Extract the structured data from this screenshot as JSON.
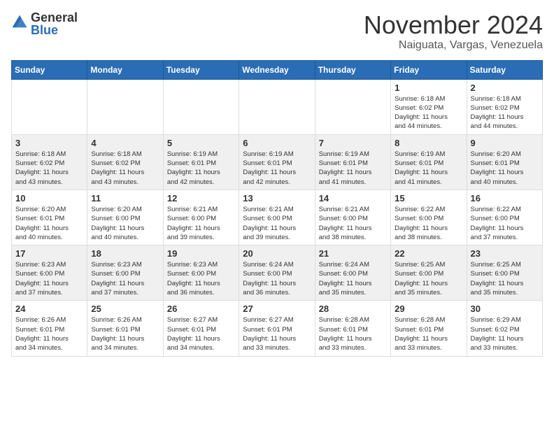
{
  "header": {
    "logo_general": "General",
    "logo_blue": "Blue",
    "month_title": "November 2024",
    "location": "Naiguata, Vargas, Venezuela"
  },
  "calendar": {
    "days_of_week": [
      "Sunday",
      "Monday",
      "Tuesday",
      "Wednesday",
      "Thursday",
      "Friday",
      "Saturday"
    ],
    "weeks": [
      [
        {
          "day": "",
          "info": ""
        },
        {
          "day": "",
          "info": ""
        },
        {
          "day": "",
          "info": ""
        },
        {
          "day": "",
          "info": ""
        },
        {
          "day": "",
          "info": ""
        },
        {
          "day": "1",
          "info": "Sunrise: 6:18 AM\nSunset: 6:02 PM\nDaylight: 11 hours\nand 44 minutes."
        },
        {
          "day": "2",
          "info": "Sunrise: 6:18 AM\nSunset: 6:02 PM\nDaylight: 11 hours\nand 44 minutes."
        }
      ],
      [
        {
          "day": "3",
          "info": "Sunrise: 6:18 AM\nSunset: 6:02 PM\nDaylight: 11 hours\nand 43 minutes."
        },
        {
          "day": "4",
          "info": "Sunrise: 6:18 AM\nSunset: 6:02 PM\nDaylight: 11 hours\nand 43 minutes."
        },
        {
          "day": "5",
          "info": "Sunrise: 6:19 AM\nSunset: 6:01 PM\nDaylight: 11 hours\nand 42 minutes."
        },
        {
          "day": "6",
          "info": "Sunrise: 6:19 AM\nSunset: 6:01 PM\nDaylight: 11 hours\nand 42 minutes."
        },
        {
          "day": "7",
          "info": "Sunrise: 6:19 AM\nSunset: 6:01 PM\nDaylight: 11 hours\nand 41 minutes."
        },
        {
          "day": "8",
          "info": "Sunrise: 6:19 AM\nSunset: 6:01 PM\nDaylight: 11 hours\nand 41 minutes."
        },
        {
          "day": "9",
          "info": "Sunrise: 6:20 AM\nSunset: 6:01 PM\nDaylight: 11 hours\nand 40 minutes."
        }
      ],
      [
        {
          "day": "10",
          "info": "Sunrise: 6:20 AM\nSunset: 6:01 PM\nDaylight: 11 hours\nand 40 minutes."
        },
        {
          "day": "11",
          "info": "Sunrise: 6:20 AM\nSunset: 6:00 PM\nDaylight: 11 hours\nand 40 minutes."
        },
        {
          "day": "12",
          "info": "Sunrise: 6:21 AM\nSunset: 6:00 PM\nDaylight: 11 hours\nand 39 minutes."
        },
        {
          "day": "13",
          "info": "Sunrise: 6:21 AM\nSunset: 6:00 PM\nDaylight: 11 hours\nand 39 minutes."
        },
        {
          "day": "14",
          "info": "Sunrise: 6:21 AM\nSunset: 6:00 PM\nDaylight: 11 hours\nand 38 minutes."
        },
        {
          "day": "15",
          "info": "Sunrise: 6:22 AM\nSunset: 6:00 PM\nDaylight: 11 hours\nand 38 minutes."
        },
        {
          "day": "16",
          "info": "Sunrise: 6:22 AM\nSunset: 6:00 PM\nDaylight: 11 hours\nand 37 minutes."
        }
      ],
      [
        {
          "day": "17",
          "info": "Sunrise: 6:23 AM\nSunset: 6:00 PM\nDaylight: 11 hours\nand 37 minutes."
        },
        {
          "day": "18",
          "info": "Sunrise: 6:23 AM\nSunset: 6:00 PM\nDaylight: 11 hours\nand 37 minutes."
        },
        {
          "day": "19",
          "info": "Sunrise: 6:23 AM\nSunset: 6:00 PM\nDaylight: 11 hours\nand 36 minutes."
        },
        {
          "day": "20",
          "info": "Sunrise: 6:24 AM\nSunset: 6:00 PM\nDaylight: 11 hours\nand 36 minutes."
        },
        {
          "day": "21",
          "info": "Sunrise: 6:24 AM\nSunset: 6:00 PM\nDaylight: 11 hours\nand 35 minutes."
        },
        {
          "day": "22",
          "info": "Sunrise: 6:25 AM\nSunset: 6:00 PM\nDaylight: 11 hours\nand 35 minutes."
        },
        {
          "day": "23",
          "info": "Sunrise: 6:25 AM\nSunset: 6:00 PM\nDaylight: 11 hours\nand 35 minutes."
        }
      ],
      [
        {
          "day": "24",
          "info": "Sunrise: 6:26 AM\nSunset: 6:01 PM\nDaylight: 11 hours\nand 34 minutes."
        },
        {
          "day": "25",
          "info": "Sunrise: 6:26 AM\nSunset: 6:01 PM\nDaylight: 11 hours\nand 34 minutes."
        },
        {
          "day": "26",
          "info": "Sunrise: 6:27 AM\nSunset: 6:01 PM\nDaylight: 11 hours\nand 34 minutes."
        },
        {
          "day": "27",
          "info": "Sunrise: 6:27 AM\nSunset: 6:01 PM\nDaylight: 11 hours\nand 33 minutes."
        },
        {
          "day": "28",
          "info": "Sunrise: 6:28 AM\nSunset: 6:01 PM\nDaylight: 11 hours\nand 33 minutes."
        },
        {
          "day": "29",
          "info": "Sunrise: 6:28 AM\nSunset: 6:01 PM\nDaylight: 11 hours\nand 33 minutes."
        },
        {
          "day": "30",
          "info": "Sunrise: 6:29 AM\nSunset: 6:02 PM\nDaylight: 11 hours\nand 33 minutes."
        }
      ]
    ]
  }
}
